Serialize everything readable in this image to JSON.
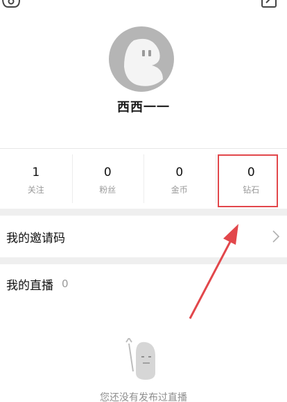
{
  "profile": {
    "username": "西西一一"
  },
  "stats": [
    {
      "value": "1",
      "label": "关注"
    },
    {
      "value": "0",
      "label": "粉丝"
    },
    {
      "value": "0",
      "label": "金币"
    },
    {
      "value": "0",
      "label": "钻石"
    }
  ],
  "rows": {
    "invite_code": {
      "title": "我的邀请码"
    },
    "live": {
      "title": "我的直播",
      "count": "0"
    }
  },
  "empty_state": {
    "text": "您还没有发布过直播"
  },
  "icons": {
    "top_left": "settings-icon",
    "top_right": "edit-icon",
    "row_chevron": "chevron-right-icon"
  },
  "colors": {
    "annotation": "#e2474b",
    "avatar": "#b5b5b5"
  }
}
